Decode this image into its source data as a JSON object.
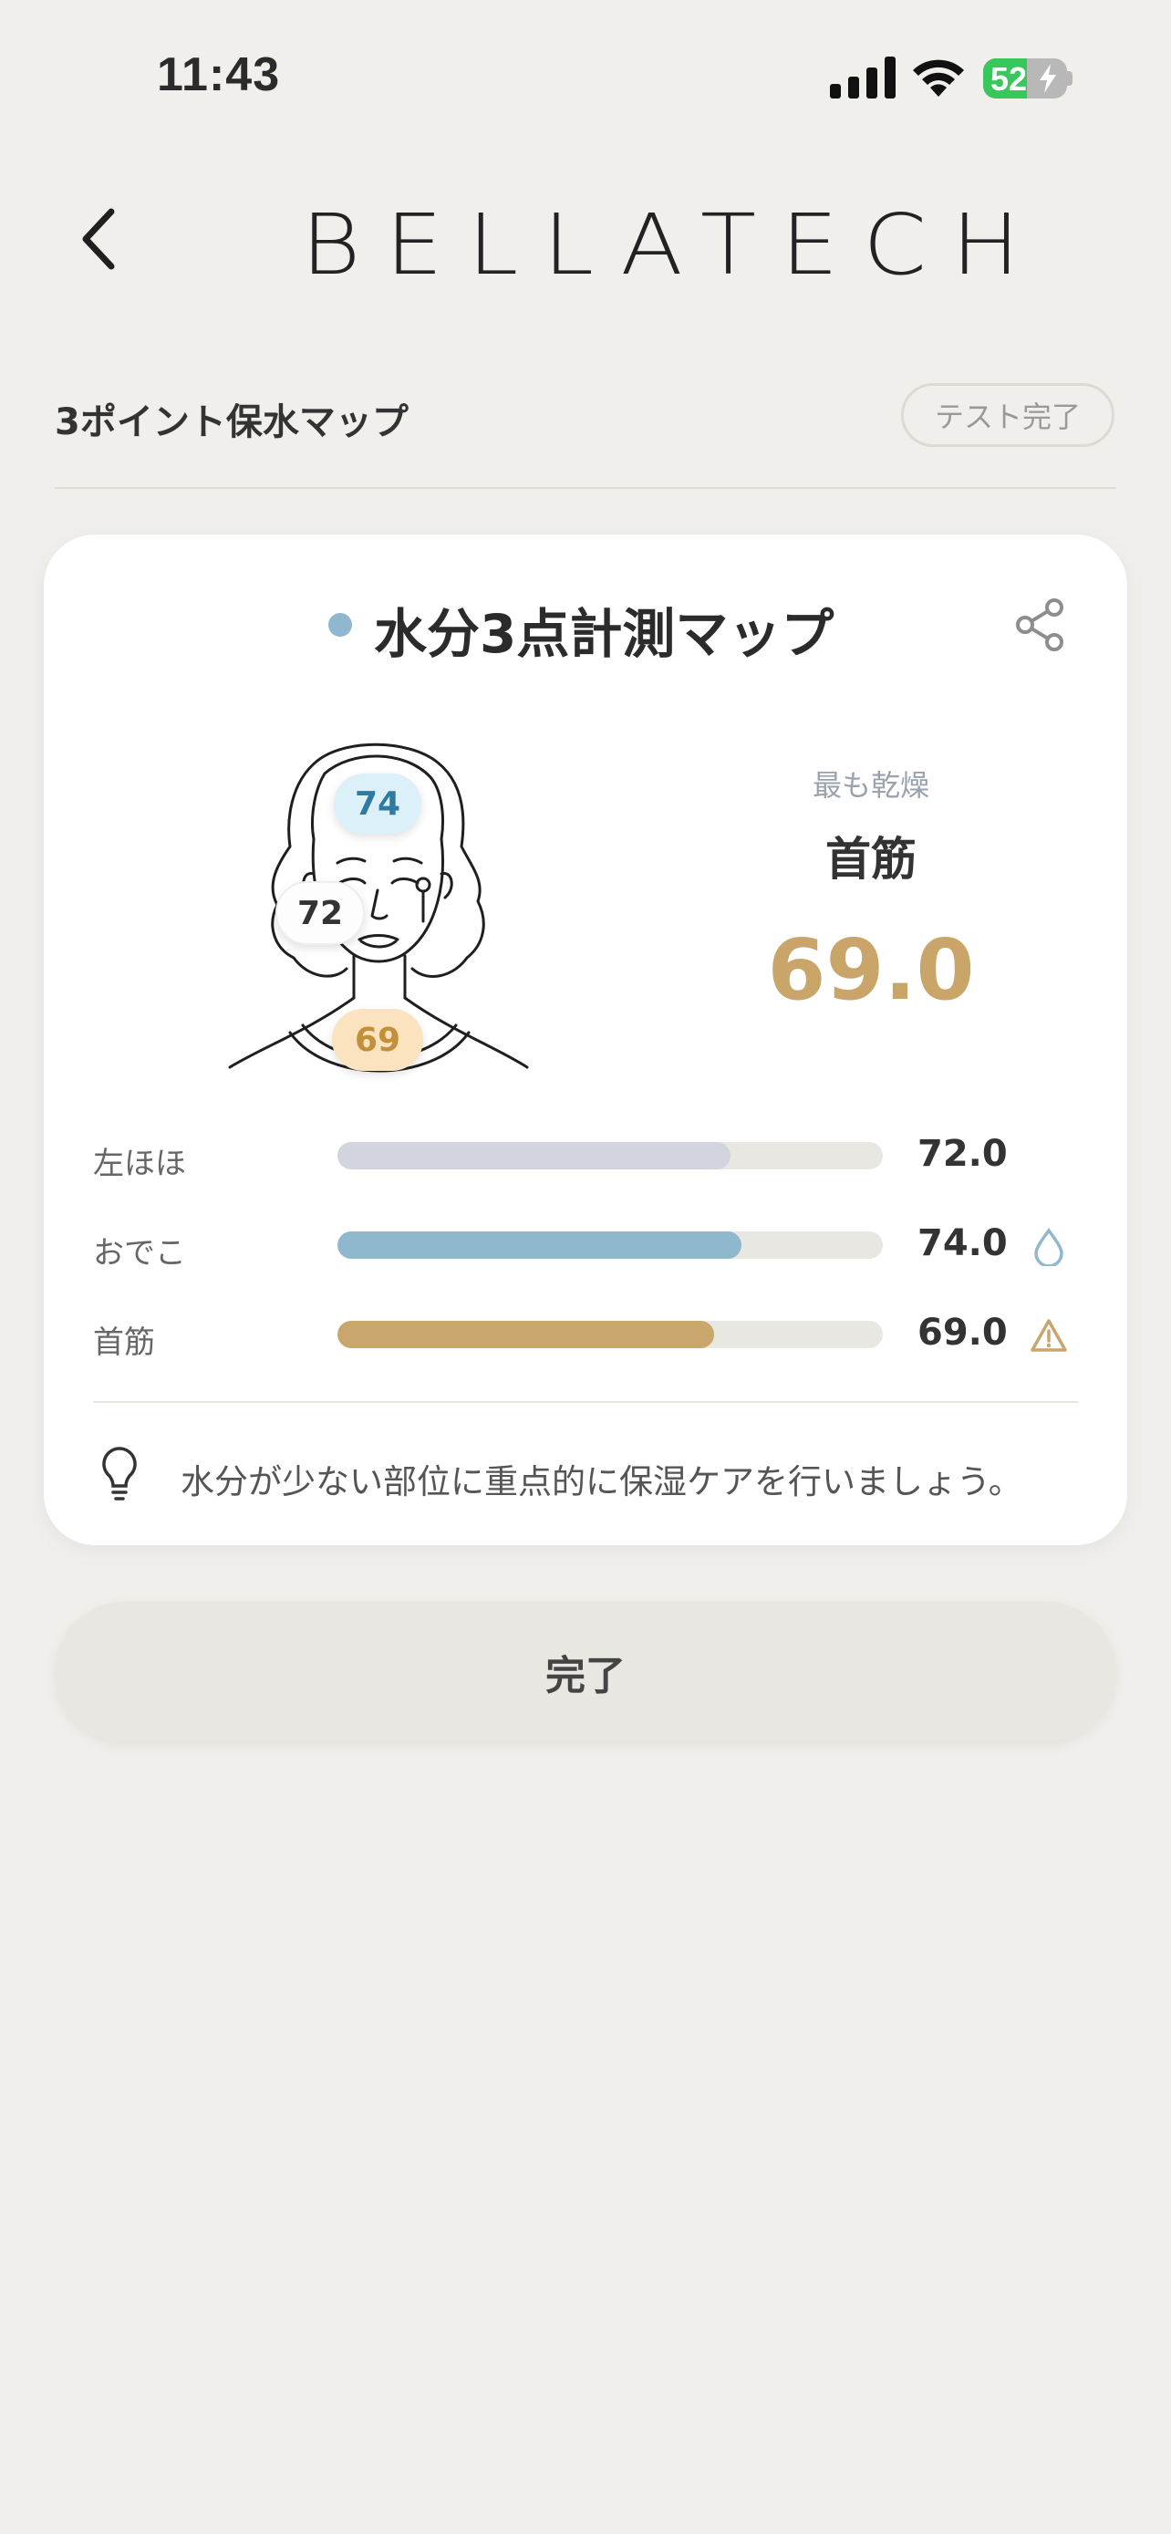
{
  "status_bar": {
    "time": "11:43",
    "battery": "52",
    "battery_level": 0.52
  },
  "header": {
    "brand": "BELLATECH"
  },
  "section": {
    "title": "3ポイント保水マップ",
    "status_pill": "テスト完了"
  },
  "card": {
    "title": "水分3点計測マップ",
    "badges": {
      "forehead": "74",
      "left_cheek": "72",
      "neck": "69"
    },
    "driest": {
      "label": "最も乾燥",
      "area": "首筋",
      "value": "69.0"
    },
    "rows": [
      {
        "label": "左ほほ",
        "value": "72.0",
        "fill": 0.72,
        "color": "#d3d5de",
        "icon": "none"
      },
      {
        "label": "おでこ",
        "value": "74.0",
        "fill": 0.74,
        "color": "#8fb8cf",
        "icon": "water-drop-icon"
      },
      {
        "label": "首筋",
        "value": "69.0",
        "fill": 0.69,
        "color": "#c8a66c",
        "icon": "warning-icon"
      }
    ],
    "tip": "水分が少ない部位に重点的に保湿ケアを行いましょう。"
  },
  "actions": {
    "done_label": "完了"
  },
  "colors": {
    "accent_gold": "#c9a56a",
    "accent_blue": "#8fb8cf",
    "background": "#f0efec"
  }
}
